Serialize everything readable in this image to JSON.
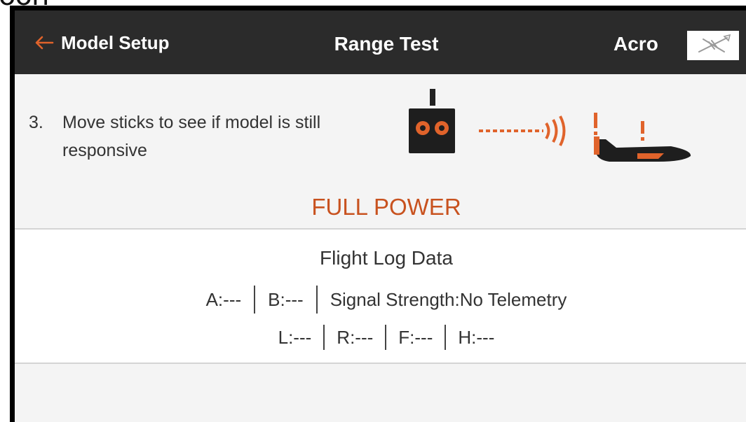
{
  "clipped_top_text": "oon",
  "header": {
    "back_label": "Model Setup",
    "title": "Range Test",
    "model_name": "Acro"
  },
  "step": {
    "number": "3.",
    "text": "Move sticks to see if model is still responsive"
  },
  "mode_label": "FULL POWER",
  "flight_log": {
    "title": "Flight Log Data",
    "row1": [
      "A:---",
      "B:---",
      "Signal Strength:No Telemetry"
    ],
    "row2": [
      "L:---",
      "R:---",
      "F:---",
      "H:---"
    ]
  },
  "colors": {
    "header_bg": "#2b2b2b",
    "accent_orange": "#e0632b",
    "mode_text": "#c8521f",
    "content_bg": "#f4f4f4"
  },
  "icons": [
    "back-arrow-icon",
    "airplane-thumbnail-icon",
    "transmitter-icon",
    "signal-wave-icon",
    "warning-icon",
    "airplane-icon"
  ]
}
